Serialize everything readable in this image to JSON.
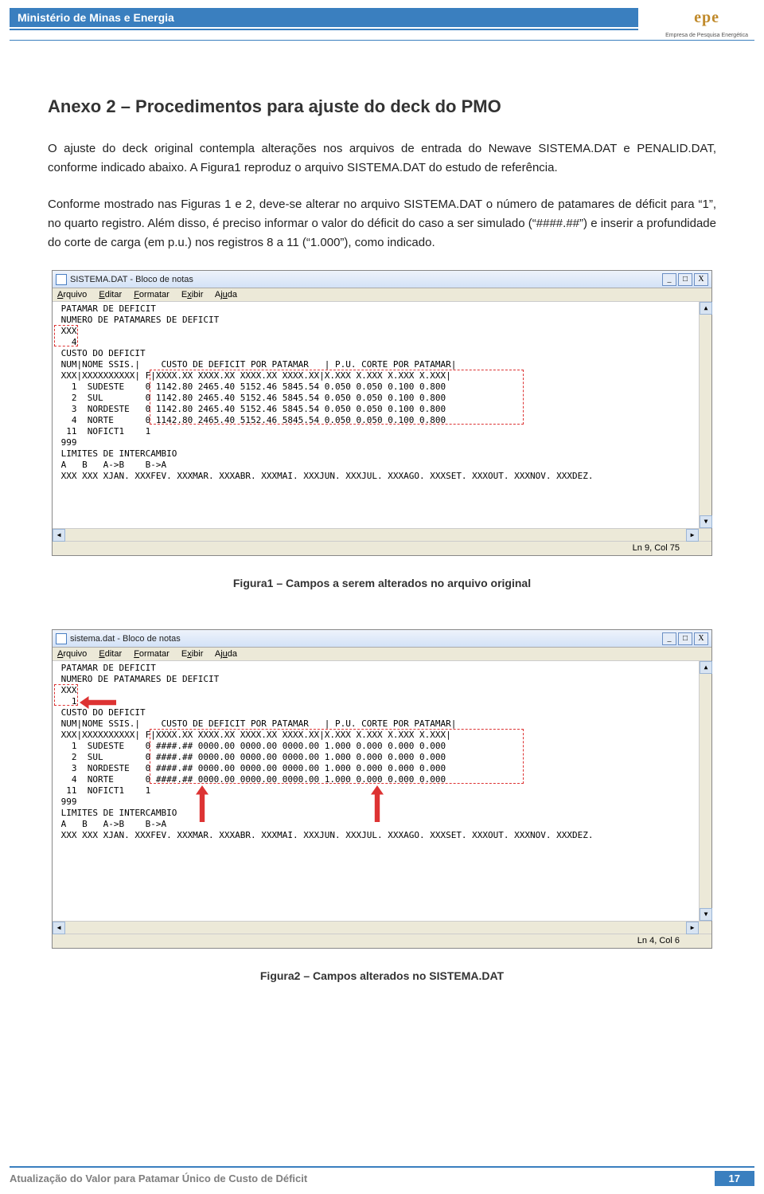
{
  "header": {
    "ministry": "Ministério de Minas e Energia",
    "logo_text": "epe",
    "logo_sub": "Empresa de Pesquisa Energética"
  },
  "anexo_title": "Anexo 2 – Procedimentos para ajuste do deck do PMO",
  "para1": "O ajuste do deck original contempla alterações nos arquivos de entrada do Newave SISTEMA.DAT e PENALID.DAT, conforme indicado abaixo. A Figura1 reproduz o arquivo SISTEMA.DAT do estudo de referência.",
  "para2": "Conforme mostrado nas Figuras 1 e 2, deve-se alterar no arquivo SISTEMA.DAT o número de patamares de déficit para “1”, no quarto registro. Além disso, é preciso informar o valor do déficit do caso a ser simulado (“####.##”) e inserir a profundidade do corte de carga (em p.u.) nos registros 8 a 11 (“1.000”), como indicado.",
  "notepad1": {
    "title": "SISTEMA.DAT - Bloco de notas",
    "menus": [
      "Arquivo",
      "Editar",
      "Formatar",
      "Exibir",
      "Ajuda"
    ],
    "lines": [
      " PATAMAR DE DEFICIT",
      " NUMERO DE PATAMARES DE DEFICIT",
      " XXX",
      "   4",
      " CUSTO DO DEFICIT",
      " NUM|NOME SSIS.|    CUSTO DE DEFICIT POR PATAMAR   | P.U. CORTE POR PATAMAR|",
      " XXX|XXXXXXXXXX| F|XXXX.XX XXXX.XX XXXX.XX XXXX.XX|X.XXX X.XXX X.XXX X.XXX|",
      "   1  SUDESTE    0 1142.80 2465.40 5152.46 5845.54 0.050 0.050 0.100 0.800",
      "   2  SUL        0 1142.80 2465.40 5152.46 5845.54 0.050 0.050 0.100 0.800",
      "   3  NORDESTE   0 1142.80 2465.40 5152.46 5845.54 0.050 0.050 0.100 0.800",
      "   4  NORTE      0 1142.80 2465.40 5152.46 5845.54 0.050 0.050 0.100 0.800",
      "  11  NOFICT1    1",
      " 999",
      " LIMITES DE INTERCAMBIO",
      " A   B   A->B    B->A",
      " XXX XXX XJAN. XXXFEV. XXXMAR. XXXABR. XXXMAI. XXXJUN. XXXJUL. XXXAGO. XXXSET. XXXOUT. XXXNOV. XXXDEZ."
    ],
    "status": "Ln 9, Col 75"
  },
  "caption1": "Figura1 – Campos a serem alterados no arquivo original",
  "notepad2": {
    "title": "sistema.dat - Bloco de notas",
    "menus": [
      "Arquivo",
      "Editar",
      "Formatar",
      "Exibir",
      "Ajuda"
    ],
    "lines": [
      " PATAMAR DE DEFICIT",
      " NUMERO DE PATAMARES DE DEFICIT",
      " XXX",
      "   1",
      " CUSTO DO DEFICIT",
      " NUM|NOME SSIS.|    CUSTO DE DEFICIT POR PATAMAR   | P.U. CORTE POR PATAMAR|",
      " XXX|XXXXXXXXXX| F|XXXX.XX XXXX.XX XXXX.XX XXXX.XX|X.XXX X.XXX X.XXX X.XXX|",
      "   1  SUDESTE    0 ####.## 0000.00 0000.00 0000.00 1.000 0.000 0.000 0.000",
      "   2  SUL        0 ####.## 0000.00 0000.00 0000.00 1.000 0.000 0.000 0.000",
      "   3  NORDESTE   0 ####.## 0000.00 0000.00 0000.00 1.000 0.000 0.000 0.000",
      "   4  NORTE      0 ####.## 0000.00 0000.00 0000.00 1.000 0.000 0.000 0.000",
      "  11  NOFICT1    1",
      " 999",
      " LIMITES DE INTERCAMBIO",
      " A   B   A->B    B->A",
      " XXX XXX XJAN. XXXFEV. XXXMAR. XXXABR. XXXMAI. XXXJUN. XXXJUL. XXXAGO. XXXSET. XXXOUT. XXXNOV. XXXDEZ."
    ],
    "status": "Ln 4, Col 6"
  },
  "caption2": "Figura2 – Campos alterados no SISTEMA.DAT",
  "footer": {
    "text": "Atualização do Valor para Patamar Único de Custo de Déficit",
    "page": "17"
  },
  "win_min": "_",
  "win_max": "□",
  "win_close": "X",
  "sb_up": "▲",
  "sb_down": "▼",
  "sb_left": "◀",
  "sb_right": "▶"
}
